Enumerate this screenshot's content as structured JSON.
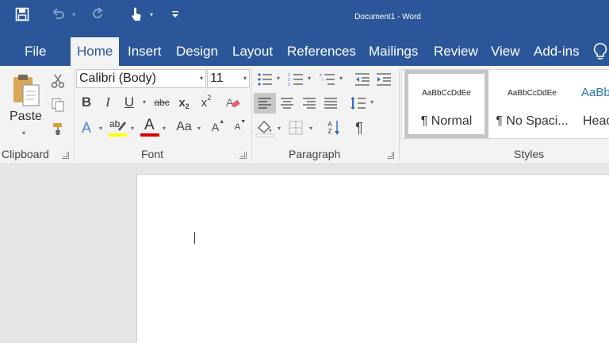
{
  "window": {
    "title": "Document1 - Word"
  },
  "tabs": [
    {
      "label": "File"
    },
    {
      "label": "Home"
    },
    {
      "label": "Insert"
    },
    {
      "label": "Design"
    },
    {
      "label": "Layout"
    },
    {
      "label": "References"
    },
    {
      "label": "Mailings"
    },
    {
      "label": "Review"
    },
    {
      "label": "View"
    },
    {
      "label": "Add-ins"
    }
  ],
  "active_tab": "Home",
  "clipboard": {
    "paste_label": "Paste",
    "group_label": "Clipboard"
  },
  "font": {
    "family": "Calibri (Body)",
    "size": "11",
    "group_label": "Font",
    "bold": "B",
    "italic": "I",
    "underline": "U",
    "strike": "abc",
    "subscript": "x",
    "subscript_mark": "2",
    "superscript": "x",
    "superscript_mark": "2",
    "change_case": "Aa",
    "grow": "A",
    "shrink": "A",
    "effects": "A",
    "highlight": "ab",
    "font_color": "A",
    "highlight_color": "#ffff00",
    "font_color_value": "#e00000"
  },
  "paragraph": {
    "group_label": "Paragraph",
    "pilcrow": "¶",
    "sort": "A Z"
  },
  "styles": {
    "group_label": "Styles",
    "items": [
      {
        "sample": "AaBbCcDdEe",
        "name": "¶ Normal"
      },
      {
        "sample": "AaBbCcDdEe",
        "name": "¶ No Spaci..."
      },
      {
        "sample": "AaBbC",
        "name": "Head"
      }
    ]
  },
  "colors": {
    "accent": "#2b579a",
    "ribbon": "#f3f3f3",
    "canvas": "#e6e6e6"
  }
}
